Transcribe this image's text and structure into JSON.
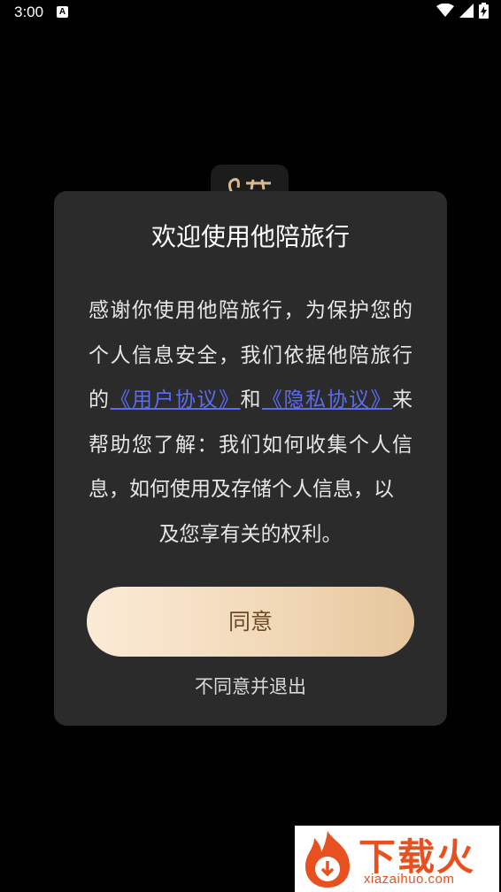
{
  "status_bar": {
    "time": "3:00",
    "notification_glyph": "A",
    "icons": [
      "wifi-icon",
      "signal-icon",
      "battery-charging-icon"
    ]
  },
  "background_logo": {
    "icon": "app-logo-icon"
  },
  "dialog": {
    "title": "欢迎使用他陪旅行",
    "body_part1": "感谢你使用他陪旅行，为保护您的个人信息安全，我们依据他陪旅行的",
    "user_agreement_link": "《用户协议》",
    "connector": "和",
    "privacy_link": "《隐私协议》",
    "body_part2": "来帮助您了解：我们如何收集个人信息，如何使用及存储个人信息，以",
    "body_part3": "及您享有关的权利。",
    "agree_button": "同意",
    "disagree_link": "不同意并退出"
  },
  "watermark": {
    "title": "下载火",
    "url": "xiazaihuo.com",
    "icon": "flame-download-icon"
  },
  "colors": {
    "background": "#000000",
    "dialog_bg": "#2b2b2b",
    "link": "#5b6cf0",
    "button_gradient_start": "#fbebd6",
    "button_gradient_end": "#e6c69b",
    "button_text": "#6b4a25",
    "watermark_accent": "#e8511f"
  }
}
